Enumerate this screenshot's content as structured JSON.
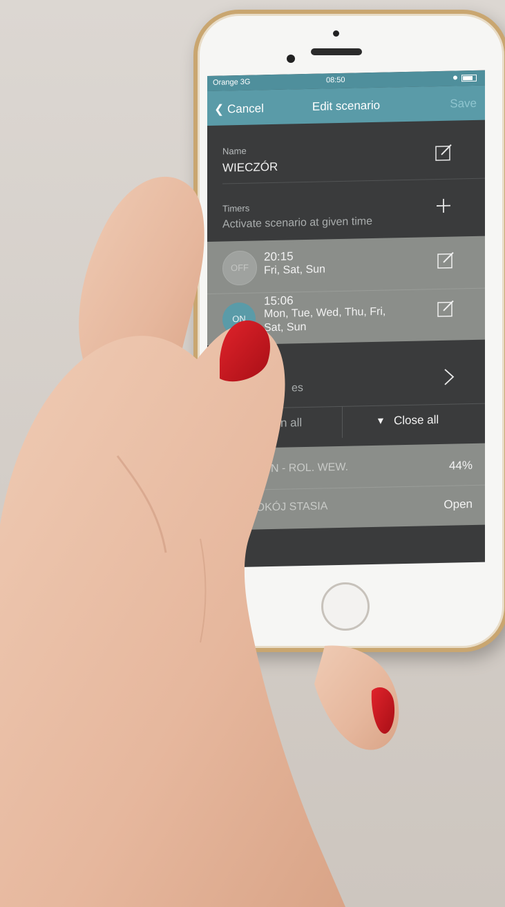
{
  "status": {
    "carrier": "Orange  3G",
    "time": "08:50"
  },
  "nav": {
    "cancel_label": "Cancel",
    "title": "Edit scenario",
    "save_label": "Save"
  },
  "name_section": {
    "label": "Name",
    "value": "WIECZÓR"
  },
  "timers_section": {
    "label": "Timers",
    "hint": "Activate scenario at given time"
  },
  "timers": [
    {
      "state": "OFF",
      "time": "20:15",
      "days": "Fri, Sat, Sun"
    },
    {
      "state": "ON",
      "time": "15:06",
      "days_line1": "Mon, Tue, Wed, Thu, Fri,",
      "days_line2": "Sat, Sun"
    }
  ],
  "devices_section": {
    "partial_label": "es"
  },
  "actions": {
    "open_all_partial": "n all",
    "close_all": "Close all"
  },
  "devices": [
    {
      "name_partial": "ALON - ROL. WEW.",
      "value": "44%"
    },
    {
      "name_partial": "POKÓJ STASIA",
      "value": "Open"
    }
  ],
  "colors": {
    "teal_header": "#5a9ba8",
    "dark_bg": "#3a3b3c",
    "gray_rows": "#8b8e8a",
    "nail": "#c8161e"
  }
}
